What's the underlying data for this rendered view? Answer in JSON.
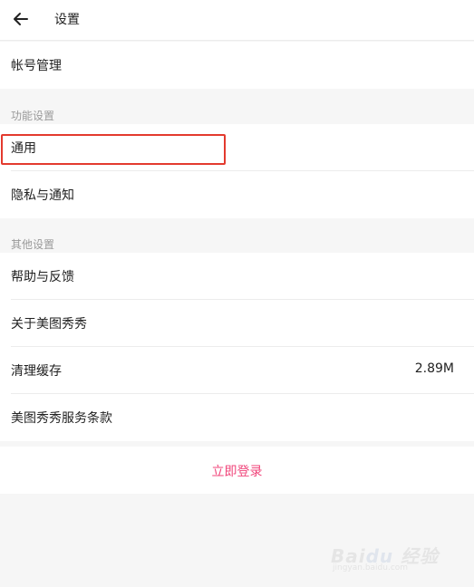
{
  "header": {
    "back_icon": "back-arrow-icon",
    "title": "设置"
  },
  "account": {
    "label": "帐号管理"
  },
  "sections": [
    {
      "title": "功能设置",
      "items": [
        {
          "label": "通用"
        },
        {
          "label": "隐私与通知"
        }
      ]
    },
    {
      "title": "其他设置",
      "items": [
        {
          "label": "帮助与反馈"
        },
        {
          "label": "关于美图秀秀"
        },
        {
          "label": "清理缓存",
          "value": "2.89M"
        },
        {
          "label": "美图秀秀服务条款"
        }
      ]
    }
  ],
  "login": {
    "label": "立即登录",
    "color": "#f0447a"
  },
  "highlight_color": "#e33a2e"
}
